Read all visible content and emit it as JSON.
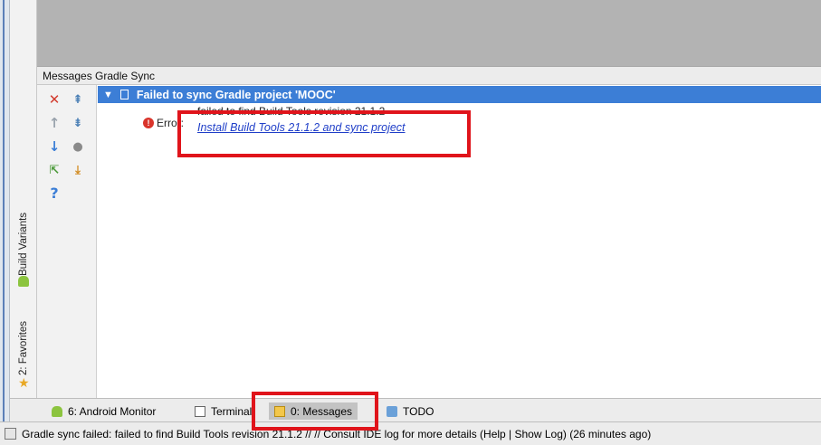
{
  "panel": {
    "title": "Messages Gradle Sync"
  },
  "sidebar": {
    "build_variants": "Build Variants",
    "favorites": "2: Favorites"
  },
  "toolbar": {
    "buttons": [
      "close-icon",
      "expand-all-icon",
      "up-arrow-icon",
      "collapse-all-icon",
      "down-arrow-icon",
      "stop-icon",
      "export-icon",
      "download-icon",
      "help-icon"
    ]
  },
  "messages": {
    "group_title": "Failed to sync Gradle project 'MOOC'",
    "error_label": "Error:",
    "error_text": "failed to find Build Tools revision 21.1.2",
    "error_link": "Install Build Tools 21.1.2 and sync project"
  },
  "bottom_tabs": [
    {
      "label": "6: Android Monitor"
    },
    {
      "label": "Terminal"
    },
    {
      "label": "0: Messages"
    },
    {
      "label": "TODO"
    }
  ],
  "status": {
    "text": "Gradle sync failed: failed to find Build Tools revision 21.1.2 // // Consult IDE log for more details (Help | Show Log) (26 minutes ago)"
  },
  "colors": {
    "selection": "#3c7ed6",
    "highlight_box": "#e0141b",
    "link": "#1f3ec8"
  }
}
